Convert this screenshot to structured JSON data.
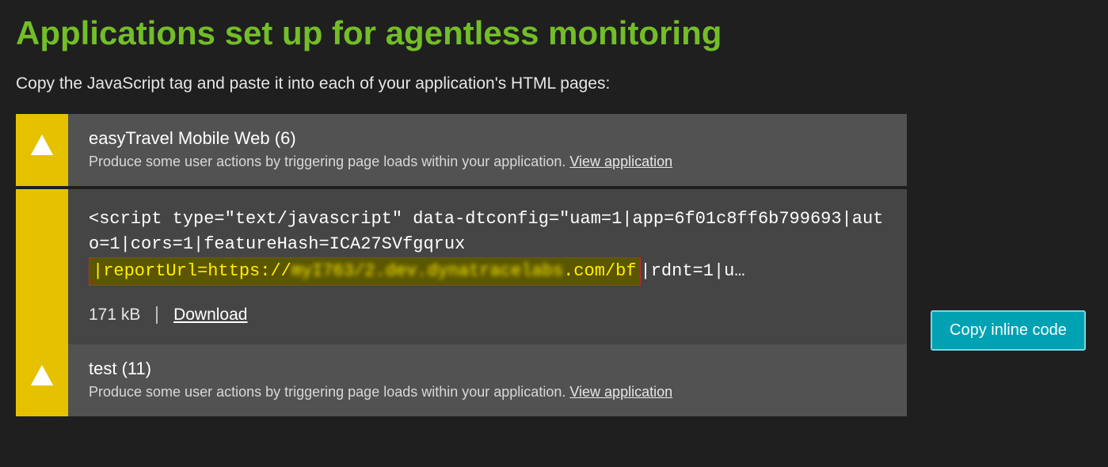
{
  "title": "Applications set up for agentless monitoring",
  "subtitle": "Copy the JavaScript tag and paste it into each of your application's HTML pages:",
  "apps": [
    {
      "name": "easyTravel Mobile Web (6)",
      "hint": "Produce some user actions by triggering page loads within your application.",
      "view_link": "View application",
      "code_pre": "<script type=\"text/javascript\" data-dtconfig=\"uam=1|app=6f01c8ff6b799693|auto=1|cors=1|featureHash=ICA27SVfgqrux",
      "highlight_plain": "|reportUrl=https://",
      "highlight_blur": "myI763/2.dev.dynatracelabs",
      "highlight_tail": ".com/bf",
      "code_post": "|rdnt=1|u…",
      "size_label": "171 kB",
      "download_label": "Download"
    },
    {
      "name": "test (11)",
      "hint": "Produce some user actions by triggering page loads within your application.",
      "view_link": "View application"
    }
  ],
  "copy_button": "Copy inline code"
}
